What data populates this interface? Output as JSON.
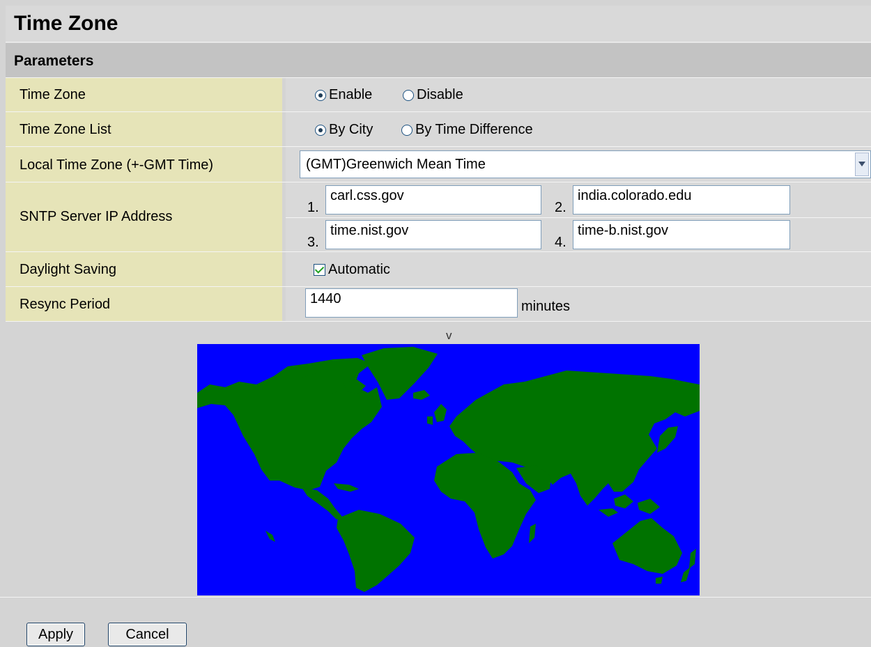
{
  "header": {
    "title": "Time Zone"
  },
  "section": {
    "title": "Parameters"
  },
  "rows": {
    "time_zone": {
      "label": "Time Zone",
      "options": [
        {
          "label": "Enable",
          "selected": true
        },
        {
          "label": "Disable",
          "selected": false
        }
      ]
    },
    "time_zone_list": {
      "label": "Time Zone List",
      "options": [
        {
          "label": "By City",
          "selected": true
        },
        {
          "label": "By Time Difference",
          "selected": false
        }
      ]
    },
    "local_time_zone": {
      "label": "Local Time Zone (+-GMT Time)",
      "selected": "(GMT)Greenwich Mean Time"
    },
    "sntp": {
      "label": "SNTP Server IP Address",
      "servers": [
        {
          "index": "1.",
          "value": "carl.css.gov"
        },
        {
          "index": "2.",
          "value": "india.colorado.edu"
        },
        {
          "index": "3.",
          "value": "time.nist.gov"
        },
        {
          "index": "4.",
          "value": "time-b.nist.gov"
        }
      ]
    },
    "daylight_saving": {
      "label": "Daylight Saving",
      "checkbox_label": "Automatic",
      "checked": true
    },
    "resync_period": {
      "label": "Resync Period",
      "value": "1440",
      "unit": "minutes"
    }
  },
  "map": {
    "marker": "v",
    "ocean_color": "#0000ff",
    "land_color": "#007300"
  },
  "buttons": {
    "apply": "Apply",
    "cancel": "Cancel"
  }
}
